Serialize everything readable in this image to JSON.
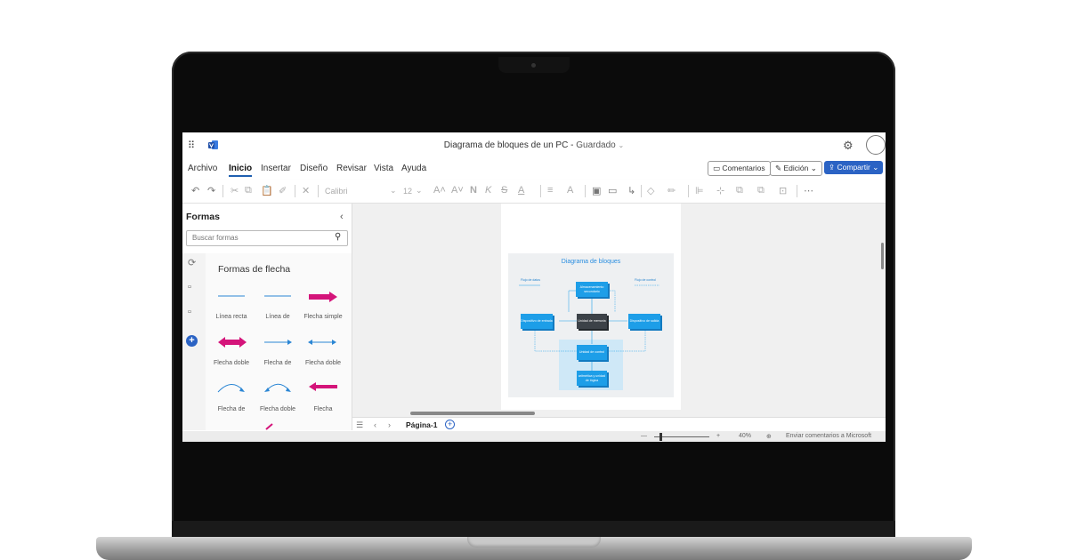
{
  "app": {
    "document_title": "Diagrama de bloques de un PC",
    "save_status": "Guardado",
    "title_separator": "-",
    "dropdown_glyph": "⌄"
  },
  "menubar": {
    "items": [
      "Archivo",
      "Inicio",
      "Insertar",
      "Diseño",
      "Revisar",
      "Vista",
      "Ayuda"
    ],
    "active": "Inicio",
    "comments_label": "Comentarios",
    "editing_label": "Edición",
    "share_label": "Compartir"
  },
  "ribbon": {
    "font_name": "Calibri",
    "font_size": "12"
  },
  "shapes_panel": {
    "title": "Formas",
    "search_placeholder": "Buscar formas",
    "category_title": "Formas de flecha",
    "shapes": [
      {
        "label": "Línea recta"
      },
      {
        "label": "Línea de"
      },
      {
        "label": "Flecha simple"
      },
      {
        "label": "Flecha doble"
      },
      {
        "label": "Flecha de"
      },
      {
        "label": "Flecha doble"
      },
      {
        "label": "Flecha de"
      },
      {
        "label": "Flecha doble"
      },
      {
        "label": "Flecha"
      }
    ]
  },
  "diagram": {
    "title": "Diagrama de bloques",
    "flow_data_label": "Flujo de datos",
    "flow_control_label": "Flujo de control",
    "blocks": {
      "secondary_storage": "Almacenamiento secundario",
      "input": "Dispositivo de entrada",
      "memory": "Unidad de memoria",
      "output": "Dispositivo de salida",
      "control": "Unidad de control",
      "alu": "aritmética y unidad de lógica"
    }
  },
  "pagetabs": {
    "current_page": "Página-1"
  },
  "statusbar": {
    "zoom_minus": "—",
    "zoom_plus": "+",
    "zoom_level": "40%",
    "feedback": "Enviar comentarios a Microsoft"
  },
  "colors": {
    "accent": "#2b63c4",
    "arrow_magenta": "#d4147a",
    "arrow_blue": "#1d9ee8",
    "block_blue": "#1d9ee8",
    "block_dark": "#3c4248"
  }
}
